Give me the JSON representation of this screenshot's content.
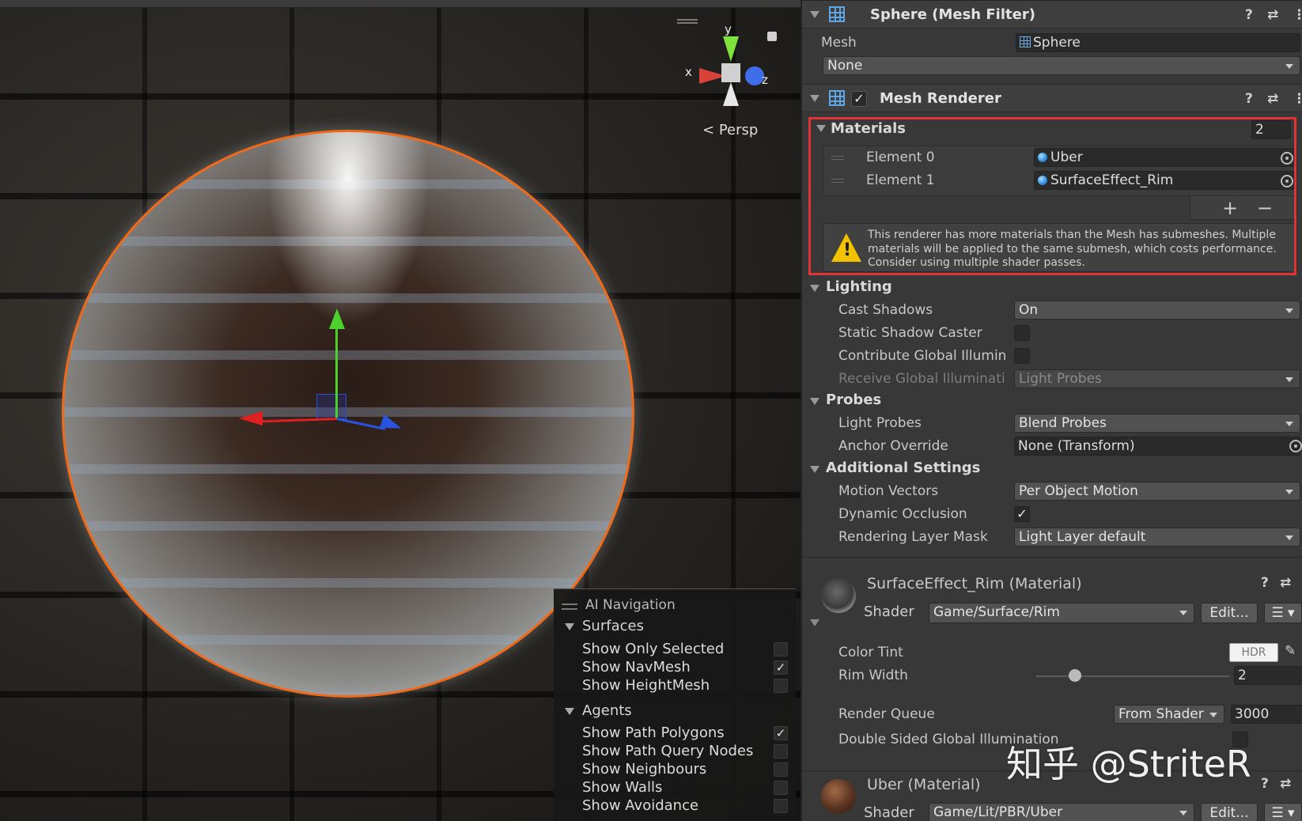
{
  "scene": {
    "persp_label": "Persp",
    "axis_labels": {
      "x": "x",
      "y": "y",
      "z": "z"
    },
    "ai_navigation": {
      "title": "AI Navigation",
      "surfaces": {
        "label": "Surfaces",
        "items": [
          {
            "label": "Show Only Selected",
            "checked": false
          },
          {
            "label": "Show NavMesh",
            "checked": true
          },
          {
            "label": "Show HeightMesh",
            "checked": false
          }
        ]
      },
      "agents": {
        "label": "Agents",
        "items": [
          {
            "label": "Show Path Polygons",
            "checked": true
          },
          {
            "label": "Show Path Query Nodes",
            "checked": false
          },
          {
            "label": "Show Neighbours",
            "checked": false
          },
          {
            "label": "Show Walls",
            "checked": false
          },
          {
            "label": "Show Avoidance",
            "checked": false
          }
        ]
      }
    }
  },
  "inspector": {
    "mesh_filter": {
      "title": "Sphere (Mesh Filter)",
      "mesh_label": "Mesh",
      "mesh_value": "Sphere",
      "none_value": "None"
    },
    "mesh_renderer": {
      "title": "Mesh Renderer",
      "enabled": true,
      "materials": {
        "label": "Materials",
        "count": "2",
        "elements": [
          {
            "label": "Element 0",
            "value": "Uber"
          },
          {
            "label": "Element 1",
            "value": "SurfaceEffect_Rim"
          }
        ],
        "add_label": "+",
        "remove_label": "−",
        "warning": "This renderer has more materials than the Mesh has submeshes. Multiple materials will be applied to the same submesh, which costs performance. Consider using multiple shader passes."
      },
      "lighting": {
        "label": "Lighting",
        "cast_shadows_label": "Cast Shadows",
        "cast_shadows_value": "On",
        "static_shadow_caster_label": "Static Shadow Caster",
        "static_shadow_caster_checked": false,
        "contribute_gi_label": "Contribute Global Illumin",
        "contribute_gi_checked": false,
        "receive_gi_label": "Receive Global Illuminati",
        "receive_gi_value": "Light Probes"
      },
      "probes": {
        "label": "Probes",
        "light_probes_label": "Light Probes",
        "light_probes_value": "Blend Probes",
        "anchor_override_label": "Anchor Override",
        "anchor_override_value": "None (Transform)"
      },
      "additional_settings": {
        "label": "Additional Settings",
        "motion_vectors_label": "Motion Vectors",
        "motion_vectors_value": "Per Object Motion",
        "dynamic_occlusion_label": "Dynamic Occlusion",
        "dynamic_occlusion_checked": true,
        "rendering_layer_mask_label": "Rendering Layer Mask",
        "rendering_layer_mask_value": "Light Layer default"
      }
    },
    "material_rim": {
      "title": "SurfaceEffect_Rim (Material)",
      "shader_label": "Shader",
      "shader_value": "Game/Surface/Rim",
      "edit_label": "Edit...",
      "color_tint_label": "Color Tint",
      "hdr_label": "HDR",
      "rim_width_label": "Rim Width",
      "rim_width_value": "2",
      "rim_width_fraction": 0.2,
      "render_queue_label": "Render Queue",
      "render_queue_mode": "From Shader",
      "render_queue_value": "3000",
      "double_sided_gi_label": "Double Sided Global Illumination"
    },
    "material_uber": {
      "title": "Uber (Material)",
      "shader_label": "Shader",
      "shader_value": "Game/Lit/PBR/Uber",
      "edit_label": "Edit..."
    }
  },
  "watermark": "知乎 @StriteR",
  "colors": {
    "selection_outline": "#f06a1a",
    "highlight_box": "#e03434",
    "warning_icon": "#f2c100",
    "object_field_icon": "#2e8de0"
  }
}
